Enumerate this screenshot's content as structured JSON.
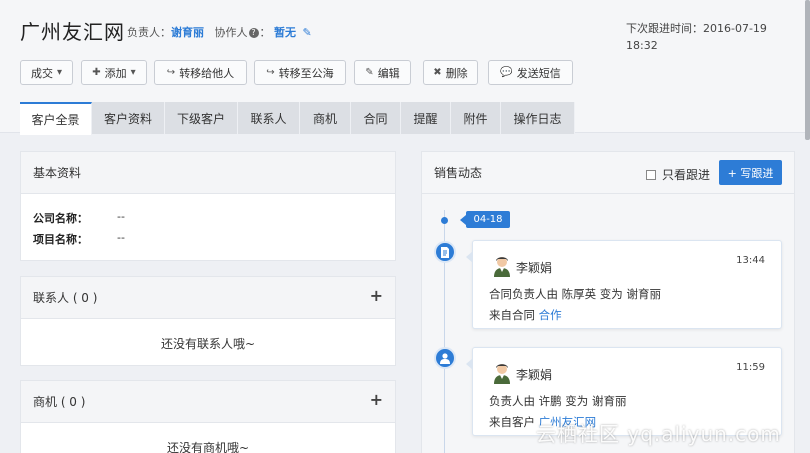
{
  "header": {
    "title": "广州友汇网",
    "owner_label": "负责人：",
    "owner_value": "谢育丽",
    "collab_label": "协作人",
    "collab_suffix": "：",
    "collab_value": "暂无",
    "next_follow": "下次跟进时间：2016-07-19 18:32"
  },
  "toolbar": {
    "deal": "成交",
    "add": "添加",
    "transfer": "转移给他人",
    "to_pool": "转移至公海",
    "edit": "编辑",
    "delete": "删除",
    "sms": "发送短信"
  },
  "tabs": [
    "客户全景",
    "客户资料",
    "下级客户",
    "联系人",
    "商机",
    "合同",
    "提醒",
    "附件",
    "操作日志"
  ],
  "basic": {
    "title": "基本资料",
    "company_label": "公司名称：",
    "company_value": "--",
    "project_label": "项目名称：",
    "project_value": "--"
  },
  "contacts": {
    "title": "联系人 ( 0 )",
    "empty": "还没有联系人哦~"
  },
  "opportunities": {
    "title": "商机 ( 0 )",
    "empty": "还没有商机哦~"
  },
  "sales": {
    "title": "销售动态",
    "only_follow": "只看跟进",
    "write_follow": "+ 写跟进",
    "date": "04-18",
    "items": [
      {
        "user": "李颖娟",
        "time": "13:44",
        "line1": "合同负责人由 陈厚英 变为 谢育丽",
        "from": "来自合同",
        "link": "合作"
      },
      {
        "user": "李颖娟",
        "time": "11:59",
        "line1": "负责人由 许鹏 变为 谢育丽",
        "from": "来自客户",
        "link": "广州友汇网"
      }
    ]
  },
  "watermark": "云栖社区 yq.aliyun.com",
  "colors": {
    "accent": "#2d7cd6"
  }
}
